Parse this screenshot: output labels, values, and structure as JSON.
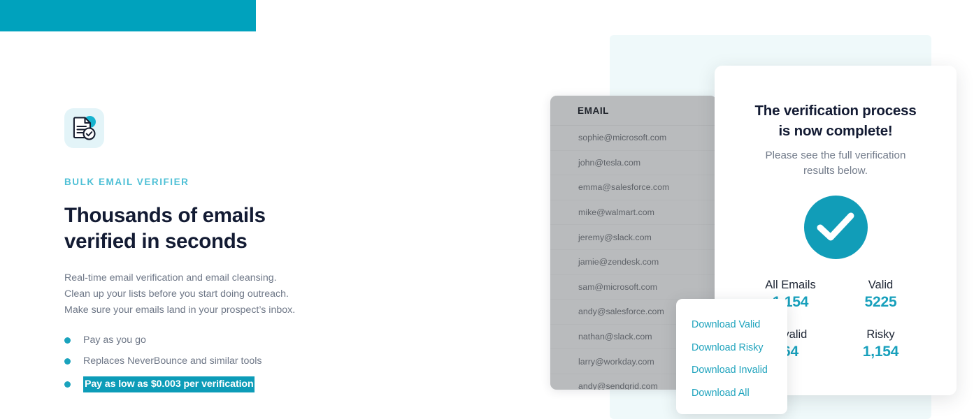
{
  "banner": {
    "label": ""
  },
  "left": {
    "icon_name": "document-verified-icon",
    "eyebrow": "BULK EMAIL VERIFIER",
    "headline_line1": "Thousands of emails",
    "headline_line2": "verified in seconds",
    "subcopy_line1": "Real-time email verification and email cleansing.",
    "subcopy_line2": "Clean up your lists before you start doing outreach.",
    "subcopy_line3": "Make sure your emails land in your prospect’s inbox.",
    "bullets": [
      {
        "text": "Pay as you go",
        "selected": false
      },
      {
        "text": "Replaces NeverBounce and similar tools",
        "selected": false
      },
      {
        "text": "Pay as low as $0.003 per verification",
        "selected": true
      }
    ]
  },
  "email_table": {
    "column_header": "EMAIL",
    "rows": [
      "sophie@microsoft.com",
      "john@tesla.com",
      "emma@salesforce.com",
      "mike@walmart.com",
      "jeremy@slack.com",
      "jamie@zendesk.com",
      "sam@microsoft.com",
      "andy@salesforce.com",
      "nathan@slack.com",
      "larry@workday.com",
      "andy@sendgrid.com"
    ]
  },
  "result_card": {
    "title_line1": "The verification process",
    "title_line2": "is now complete!",
    "subtitle_line1": "Please see the full verification",
    "subtitle_line2": "results below.",
    "check_icon": "checkmark-circle-icon",
    "stats": [
      {
        "label": "All Emails",
        "value": "1,154"
      },
      {
        "label": "Valid",
        "value": "5225"
      },
      {
        "label": "Invalid",
        "value": "64"
      },
      {
        "label": "Risky",
        "value": "1,154"
      }
    ]
  },
  "download_menu": {
    "items": [
      "Download Valid",
      "Download Risky",
      "Download Invalid",
      "Download All"
    ]
  },
  "colors": {
    "brand_teal": "#00a2bd",
    "accent_teal": "#18a0bc",
    "eyebrow_teal": "#4fc0d6",
    "selection_teal": "#0d9cb8",
    "panel_bg": "#eff9fa",
    "dim_overlay": "#b9bbbd",
    "heading_navy": "#131b33",
    "body_grey": "#6e7787"
  }
}
